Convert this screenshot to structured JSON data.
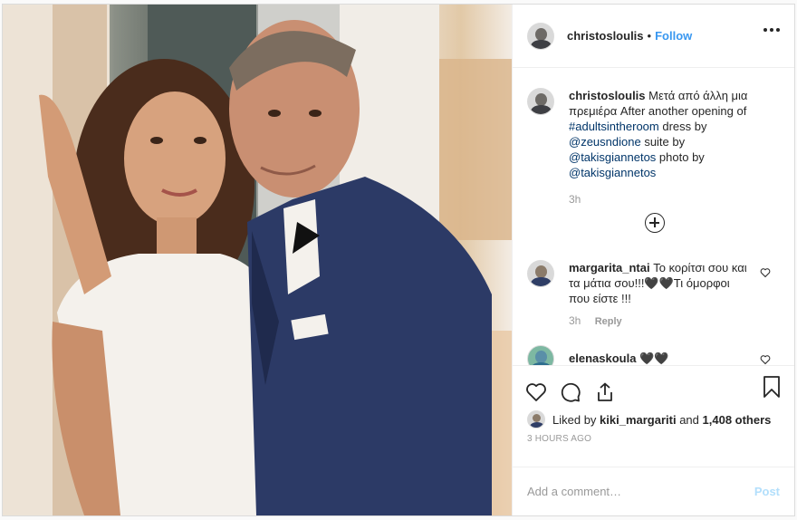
{
  "colors": {
    "accent": "#3897f0",
    "link": "#003569",
    "muted": "#999999",
    "post_disabled": "#b2dffc"
  },
  "photo": {
    "icon": "photo-of-couple"
  },
  "header": {
    "username": "christosloulis",
    "separator": "•",
    "follow_label": "Follow",
    "more_icon": "ellipsis-icon"
  },
  "caption": {
    "username": "christosloulis",
    "text_1": "Μετά από άλλη μια πρεμιέρα After another opening of ",
    "hashtag": "#adultsintheroom",
    "text_2": " dress by ",
    "mention_1": "@zeusndione",
    "text_3": " suite by ",
    "mention_2": "@takisgiannetos",
    "text_4": " photo by ",
    "mention_3": "@takisgiannetos",
    "time": "3h"
  },
  "comments": [
    {
      "username": "margarita_ntai",
      "text": "Το κορίτσι σου και τα μάτια σου!!!🖤🖤Τι όμορφοι που είστε !!!",
      "time": "3h",
      "reply_label": "Reply"
    },
    {
      "username": "elenaskoula",
      "text": "🖤🖤"
    }
  ],
  "actions": {
    "like_icon": "heart-icon",
    "comment_icon": "comment-icon",
    "share_icon": "share-icon",
    "save_icon": "bookmark-icon"
  },
  "likes": {
    "prefix": "Liked by ",
    "user": "kiki_margariti",
    "middle": " and ",
    "count": "1,408 others"
  },
  "timestamp": "3 HOURS AGO",
  "add_comment": {
    "placeholder": "Add a comment…",
    "post_label": "Post"
  }
}
